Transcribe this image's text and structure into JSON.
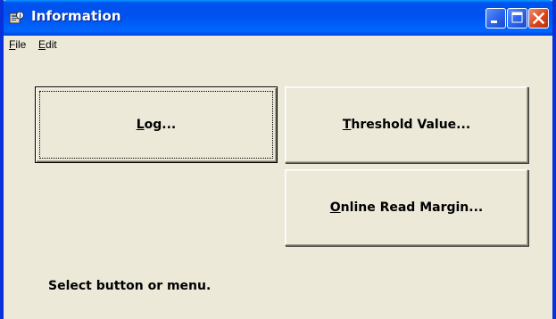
{
  "window": {
    "title": "Information",
    "icon": "application-info-icon",
    "controls": {
      "minimize": "minimize-icon",
      "maximize": "maximize-icon",
      "close": "close-icon"
    },
    "accent_color": "#0054e3",
    "face_color": "#ece9d8"
  },
  "menubar": {
    "items": [
      {
        "label": "File"
      },
      {
        "label": "Edit"
      }
    ]
  },
  "buttons": {
    "log": "Log...",
    "threshold": "Threshold Value...",
    "online": "Online Read Margin..."
  },
  "status": {
    "text": "Select button or menu."
  }
}
